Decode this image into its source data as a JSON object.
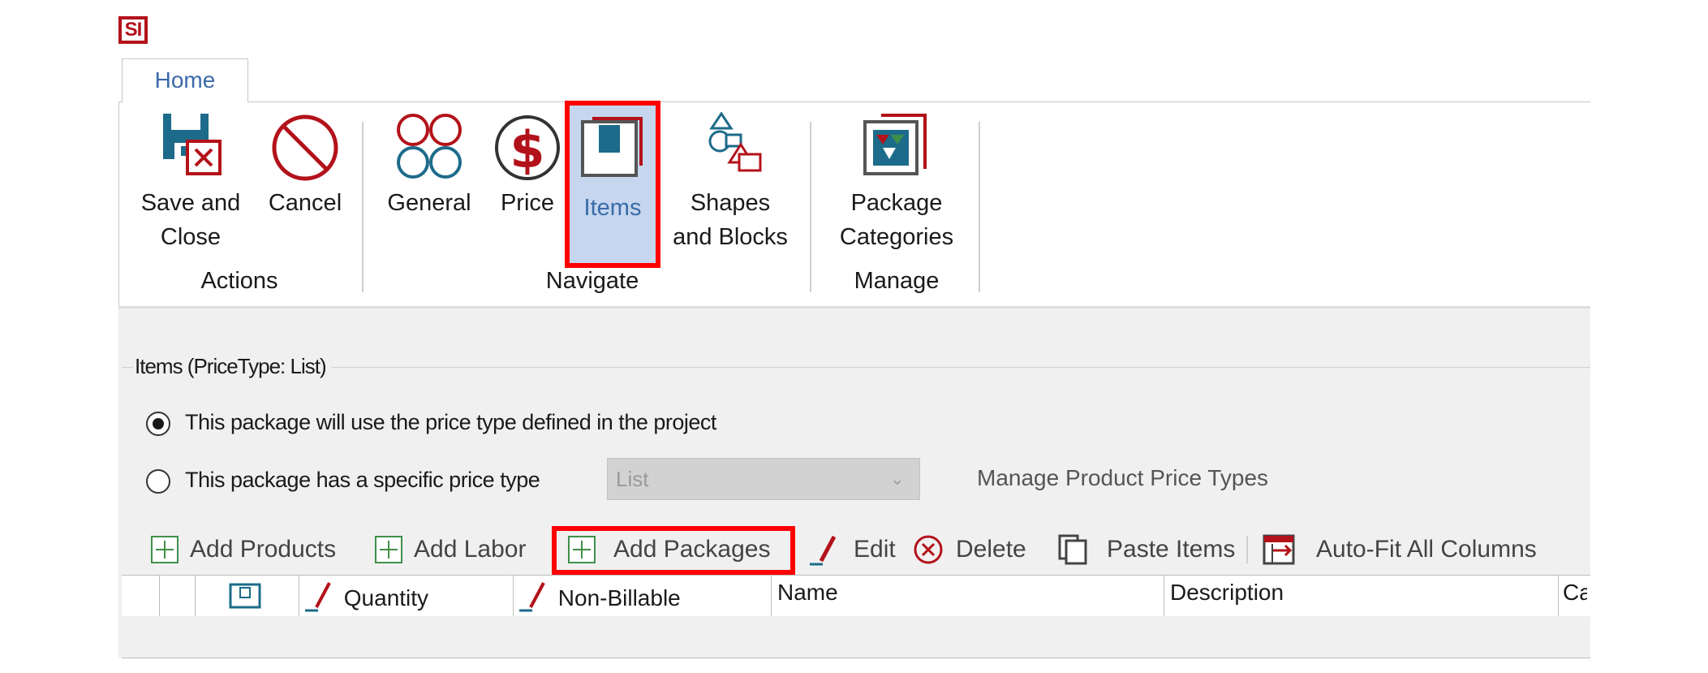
{
  "app": {
    "logo_text": "SI"
  },
  "tabs": [
    {
      "label": "Home"
    }
  ],
  "ribbon": {
    "groups": [
      {
        "label": "Actions",
        "buttons": [
          {
            "label": "Save and\nClose",
            "icon": "save-close-icon"
          },
          {
            "label": "Cancel",
            "icon": "cancel-icon"
          }
        ]
      },
      {
        "label": "Navigate",
        "buttons": [
          {
            "label": "General",
            "icon": "general-icon"
          },
          {
            "label": "Price",
            "icon": "price-icon"
          },
          {
            "label": "Items",
            "icon": "items-icon",
            "selected": true
          },
          {
            "label": "Shapes\nand Blocks",
            "icon": "shapes-blocks-icon"
          }
        ]
      },
      {
        "label": "Manage",
        "buttons": [
          {
            "label": "Package\nCategories",
            "icon": "package-categories-icon"
          }
        ]
      }
    ]
  },
  "items_group": {
    "title": "Items (PriceType: List)",
    "radio_project": {
      "label": "This package will use the price type defined in the project",
      "checked": true
    },
    "radio_specific": {
      "label": "This package has a specific price type",
      "checked": false
    },
    "price_select": {
      "value": "List"
    },
    "manage_link": "Manage Product Price Types"
  },
  "toolbar": {
    "add_products": "Add Products",
    "add_labor": "Add Labor",
    "add_packages": "Add Packages",
    "edit": "Edit",
    "delete": "Delete",
    "paste_items": "Paste Items",
    "auto_fit": "Auto-Fit All Columns"
  },
  "grid": {
    "columns": {
      "quantity": "Quantity",
      "non_billable": "Non-Billable",
      "name": "Name",
      "description": "Description",
      "category": "Ca"
    }
  },
  "colors": {
    "accent_red": "#b3121a",
    "highlight": "#ff0000",
    "selected_bg": "#c5d6ee",
    "teal": "#1d6b8a",
    "green": "#3f8f4a"
  }
}
